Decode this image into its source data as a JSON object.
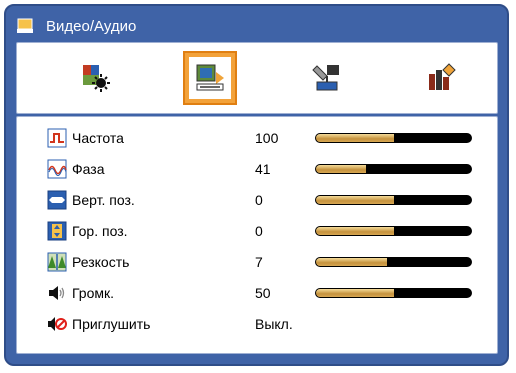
{
  "window": {
    "title": "Видео/Аудио"
  },
  "tabs": [
    {
      "name": "image-settings-icon",
      "active": false
    },
    {
      "name": "video-audio-icon",
      "active": true
    },
    {
      "name": "setup-icon",
      "active": false
    },
    {
      "name": "options-icon",
      "active": false
    }
  ],
  "items": [
    {
      "label": "Частота",
      "value": "100",
      "level": 0.5,
      "icon": "frequency-icon"
    },
    {
      "label": "Фаза",
      "value": "41",
      "level": 0.32,
      "icon": "phase-icon"
    },
    {
      "label": "Верт. поз.",
      "value": "0",
      "level": 0.5,
      "icon": "vertical-position-icon"
    },
    {
      "label": "Гор. поз.",
      "value": "0",
      "level": 0.5,
      "icon": "horizontal-position-icon"
    },
    {
      "label": "Резкость",
      "value": "7",
      "level": 0.46,
      "icon": "sharpness-icon"
    },
    {
      "label": "Громк.",
      "value": "50",
      "level": 0.5,
      "icon": "volume-icon"
    },
    {
      "label": "Приглушить",
      "value": "Выкл.",
      "icon": "mute-icon"
    }
  ],
  "colors": {
    "frame": "#3f63a7",
    "accent": "#f3a23a",
    "bar_fill": "#c5923d"
  }
}
